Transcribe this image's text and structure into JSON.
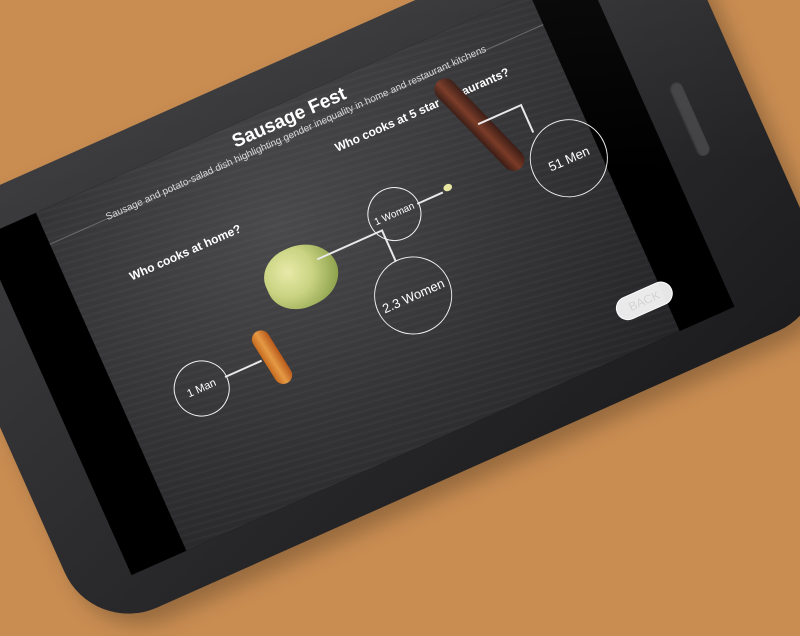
{
  "app": {
    "title": "Sausage Fest",
    "subtitle": "Sausage and potato-salad dish highlighting gender inequality in home and restaurant kitchens"
  },
  "questions": {
    "home": "Who cooks at home?",
    "restaurants": "Who cooks at 5 star restaurants?"
  },
  "labels": {
    "man": "1 Man",
    "women_home": "2.3 Women",
    "woman_rest": "1 Woman",
    "men_rest": "51 Men"
  },
  "buttons": {
    "back": "BACK"
  },
  "colors": {
    "background": "#c98d52",
    "phone_body": "#2a2a2c",
    "slate": "#333335"
  }
}
